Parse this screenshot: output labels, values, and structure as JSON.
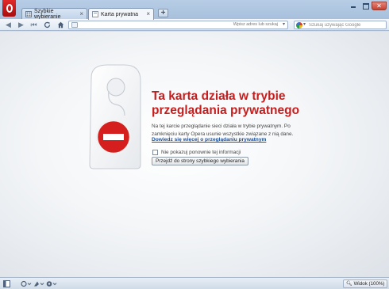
{
  "tabs": [
    {
      "label": "Szybkie wybieranie",
      "icon": "speed-dial-icon"
    },
    {
      "label": "Karta prywatna",
      "icon": "private-tab-icon"
    }
  ],
  "toolbar": {
    "url_placeholder": "Wpisz adres lub szukaj",
    "search_placeholder": "Szukaj używając Google",
    "search_engine_icon": "google-icon"
  },
  "page": {
    "title": "Ta karta działa w trybie przeglądania prywatnego",
    "description": "Na tej karcie przeglądanie sieci działa w trybie prywatnym. Po zamknięciu karty Opera usunie wszystkie związane z nią dane.",
    "learn_more": "Dowiedz się więcej o przeglądaniu prywatnym",
    "dont_show_label": "Nie pokazuj ponownie tej informacji",
    "dont_show_checked": false,
    "speed_dial_button": "Przejdź do strony szybkiego wybierania"
  },
  "statusbar": {
    "zoom": "Widok (100%)"
  },
  "colors": {
    "accent_red": "#c41e1e",
    "link_blue": "#1a4f9c",
    "chrome_blue": "#b7cde6"
  }
}
